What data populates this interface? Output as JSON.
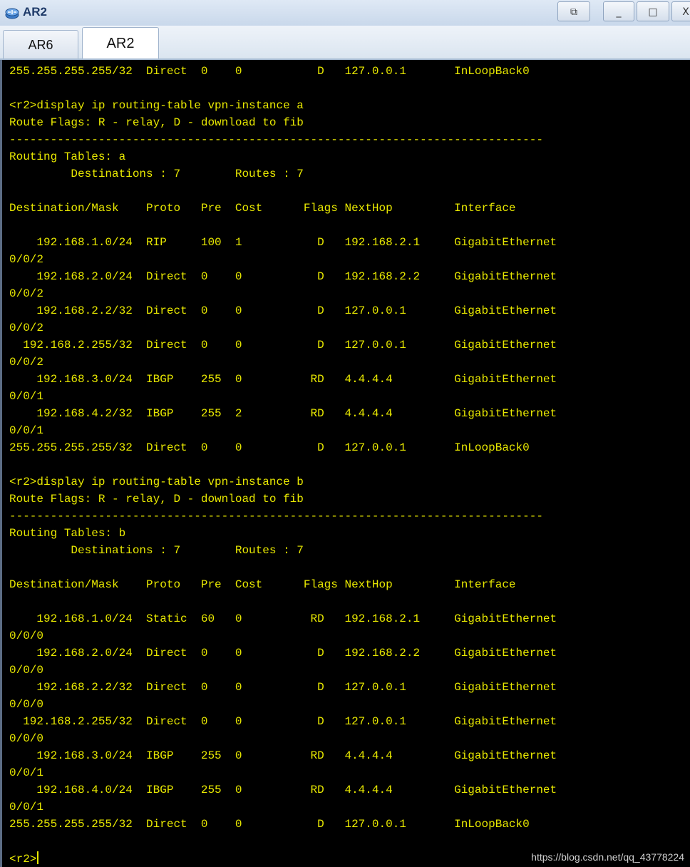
{
  "window": {
    "title": "AR2",
    "buttons": {
      "restore": "⧉",
      "minimize": "_",
      "maximize": "□",
      "close": "X"
    }
  },
  "tabs": [
    {
      "label": "AR6",
      "active": false
    },
    {
      "label": "AR2",
      "active": true
    }
  ],
  "console": {
    "lines": [
      "255.255.255.255/32  Direct  0    0           D   127.0.0.1       InLoopBack0",
      "",
      "<r2>display ip routing-table vpn-instance a",
      "Route Flags: R - relay, D - download to fib",
      "------------------------------------------------------------------------------",
      "Routing Tables: a",
      "         Destinations : 7        Routes : 7",
      "",
      "Destination/Mask    Proto   Pre  Cost      Flags NextHop         Interface",
      "",
      "    192.168.1.0/24  RIP     100  1           D   192.168.2.1     GigabitEthernet",
      "0/0/2",
      "    192.168.2.0/24  Direct  0    0           D   192.168.2.2     GigabitEthernet",
      "0/0/2",
      "    192.168.2.2/32  Direct  0    0           D   127.0.0.1       GigabitEthernet",
      "0/0/2",
      "  192.168.2.255/32  Direct  0    0           D   127.0.0.1       GigabitEthernet",
      "0/0/2",
      "    192.168.3.0/24  IBGP    255  0          RD   4.4.4.4         GigabitEthernet",
      "0/0/1",
      "    192.168.4.2/32  IBGP    255  2          RD   4.4.4.4         GigabitEthernet",
      "0/0/1",
      "255.255.255.255/32  Direct  0    0           D   127.0.0.1       InLoopBack0",
      "",
      "<r2>display ip routing-table vpn-instance b",
      "Route Flags: R - relay, D - download to fib",
      "------------------------------------------------------------------------------",
      "Routing Tables: b",
      "         Destinations : 7        Routes : 7",
      "",
      "Destination/Mask    Proto   Pre  Cost      Flags NextHop         Interface",
      "",
      "    192.168.1.0/24  Static  60   0          RD   192.168.2.1     GigabitEthernet",
      "0/0/0",
      "    192.168.2.0/24  Direct  0    0           D   192.168.2.2     GigabitEthernet",
      "0/0/0",
      "    192.168.2.2/32  Direct  0    0           D   127.0.0.1       GigabitEthernet",
      "0/0/0",
      "  192.168.2.255/32  Direct  0    0           D   127.0.0.1       GigabitEthernet",
      "0/0/0",
      "    192.168.3.0/24  IBGP    255  0          RD   4.4.4.4         GigabitEthernet",
      "0/0/1",
      "    192.168.4.0/24  IBGP    255  0          RD   4.4.4.4         GigabitEthernet",
      "0/0/1",
      "255.255.255.255/32  Direct  0    0           D   127.0.0.1       InLoopBack0",
      "",
      "<r2>"
    ],
    "text_color": "#e8e800",
    "background": "#000000"
  },
  "watermark": "https://blog.csdn.net/qq_43778224"
}
